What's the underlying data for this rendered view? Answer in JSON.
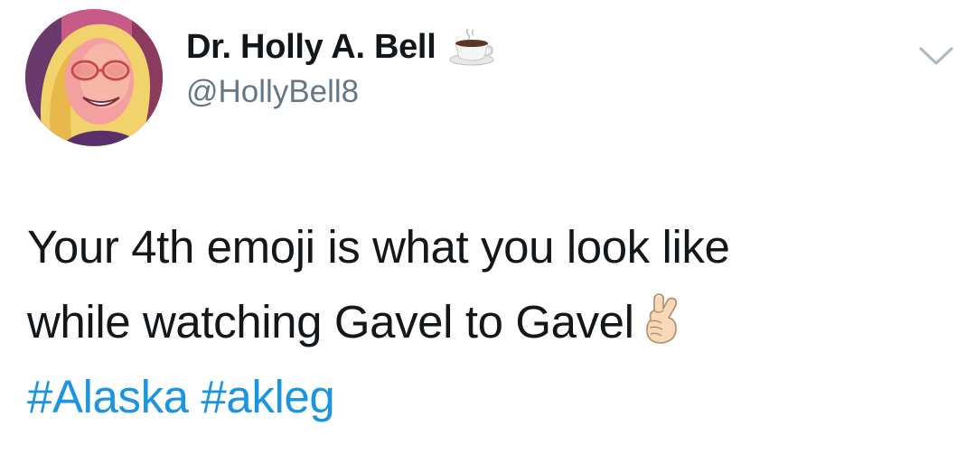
{
  "author": {
    "display_name": "Dr. Holly A. Bell",
    "name_emoji": "coffee-cup-icon",
    "handle": "@HollyBell8",
    "avatar_icon": "avatar-photo"
  },
  "menu": {
    "icon": "chevron-down-icon"
  },
  "tweet": {
    "line1": "Your 4th emoji is what you look like",
    "line2": "while watching Gavel to Gavel",
    "inline_emoji": "crossed-fingers-icon",
    "hashtags": [
      "#Alaska",
      "#akleg"
    ]
  },
  "colors": {
    "text": "#14171a",
    "secondary": "#657786",
    "link": "#1b95e0"
  }
}
